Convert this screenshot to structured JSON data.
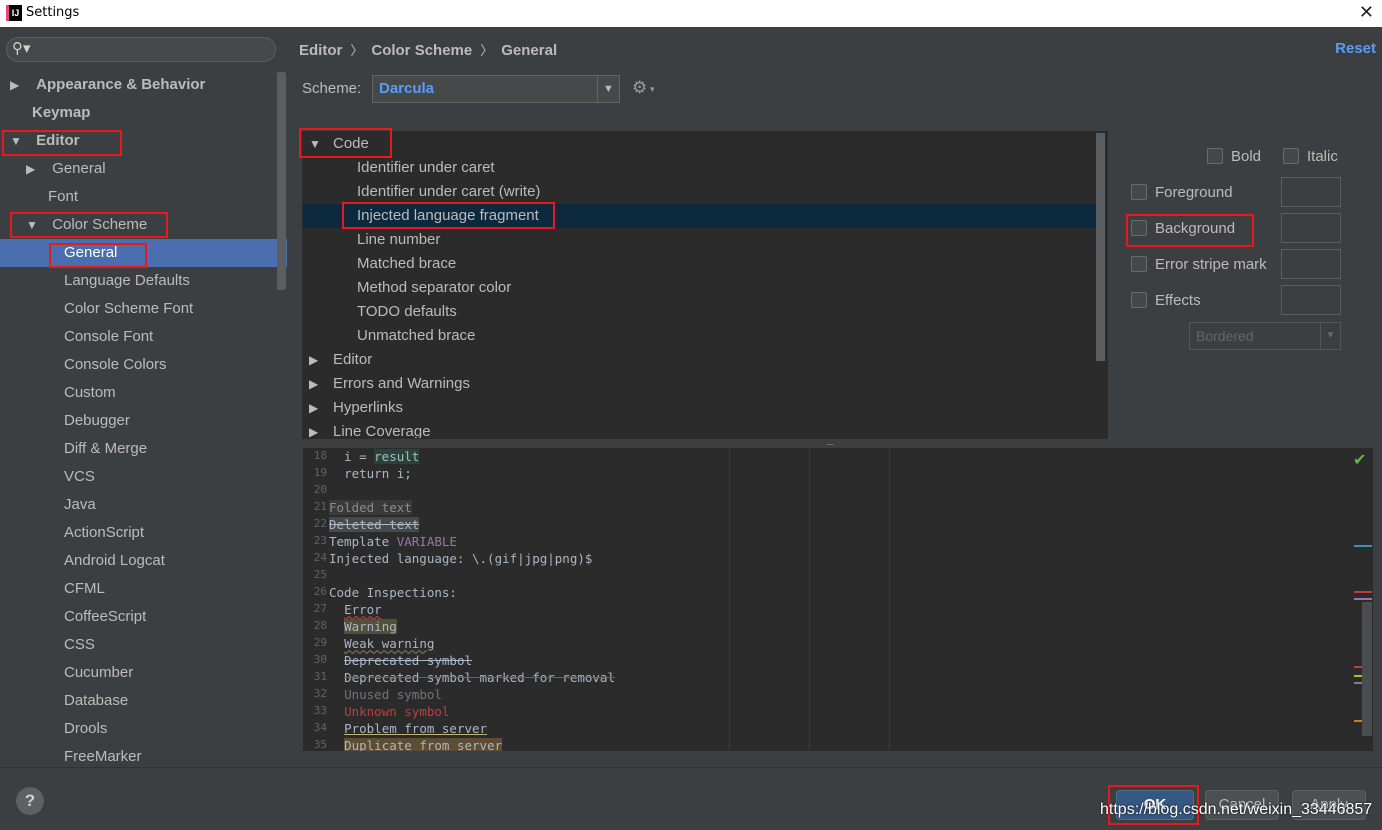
{
  "window": {
    "title": "Settings",
    "icon": "intellij-idea-icon"
  },
  "sidebar": {
    "search_placeholder": "",
    "items": [
      {
        "label": "Appearance & Behavior",
        "arrow": "▶"
      },
      {
        "label": "Keymap",
        "arrow": ""
      },
      {
        "label": "Editor",
        "arrow": "▼"
      },
      {
        "label": "General",
        "arrow": "▶"
      },
      {
        "label": "Font",
        "arrow": ""
      },
      {
        "label": "Color Scheme",
        "arrow": "▼"
      },
      {
        "label": "General",
        "arrow": ""
      },
      {
        "label": "Language Defaults",
        "arrow": ""
      },
      {
        "label": "Color Scheme Font",
        "arrow": ""
      },
      {
        "label": "Console Font",
        "arrow": ""
      },
      {
        "label": "Console Colors",
        "arrow": ""
      },
      {
        "label": "Custom",
        "arrow": ""
      },
      {
        "label": "Debugger",
        "arrow": ""
      },
      {
        "label": "Diff & Merge",
        "arrow": ""
      },
      {
        "label": "VCS",
        "arrow": ""
      },
      {
        "label": "Java",
        "arrow": ""
      },
      {
        "label": "ActionScript",
        "arrow": ""
      },
      {
        "label": "Android Logcat",
        "arrow": ""
      },
      {
        "label": "CFML",
        "arrow": ""
      },
      {
        "label": "CoffeeScript",
        "arrow": ""
      },
      {
        "label": "CSS",
        "arrow": ""
      },
      {
        "label": "Cucumber",
        "arrow": ""
      },
      {
        "label": "Database",
        "arrow": ""
      },
      {
        "label": "Drools",
        "arrow": ""
      },
      {
        "label": "FreeMarker",
        "arrow": ""
      }
    ]
  },
  "breadcrumb": [
    "Editor",
    "Color Scheme",
    "General"
  ],
  "breadcrumb_sep": "〉",
  "reset_label": "Reset",
  "scheme": {
    "label": "Scheme:",
    "value": "Darcula",
    "dropdown_glyph": "▼",
    "gear_glyph": "⚙",
    "gear_dd": "▾"
  },
  "code_tree": [
    {
      "label": "Code",
      "arrow": "▼"
    },
    {
      "label": "Identifier under caret",
      "arrow": ""
    },
    {
      "label": "Identifier under caret (write)",
      "arrow": ""
    },
    {
      "label": "Injected language fragment",
      "arrow": ""
    },
    {
      "label": "Line number",
      "arrow": ""
    },
    {
      "label": "Matched brace",
      "arrow": ""
    },
    {
      "label": "Method separator color",
      "arrow": ""
    },
    {
      "label": "TODO defaults",
      "arrow": ""
    },
    {
      "label": "Unmatched brace",
      "arrow": ""
    },
    {
      "label": "Editor",
      "arrow": "▶"
    },
    {
      "label": "Errors and Warnings",
      "arrow": "▶"
    },
    {
      "label": "Hyperlinks",
      "arrow": "▶"
    },
    {
      "label": "Line Coverage",
      "arrow": "▶"
    }
  ],
  "options": {
    "bold": "Bold",
    "italic": "Italic",
    "foreground": "Foreground",
    "background": "Background",
    "error_stripe": "Error stripe mark",
    "effects": "Effects",
    "effects_type": "Bordered",
    "effects_dd": "▼"
  },
  "editor_preview": {
    "line_numbers": [
      "18",
      "19",
      "20",
      "21",
      "22",
      "23",
      "24",
      "25",
      "26",
      "27",
      "28",
      "29",
      "30",
      "31",
      "32",
      "33",
      "34",
      "35"
    ],
    "lines": [
      "  i = result",
      "  return i;",
      "",
      "Folded text",
      "Deleted text",
      "Template VARIABLE",
      "Injected language: \\.(gif|jpg|png)$",
      "",
      "Code Inspections:",
      "  Error",
      "  Warning",
      "  Weak warning",
      "  Deprecated symbol",
      "  Deprecated symbol marked for removal",
      "  Unused symbol",
      "  Unknown symbol",
      "  Problem from server",
      "  Duplicate from server"
    ],
    "status_icon": "✔"
  },
  "footer": {
    "help": "?",
    "ok": "OK",
    "cancel": "Cancel",
    "apply": "Apply"
  },
  "watermark": "https://blog.csdn.net/weixin_33446857"
}
